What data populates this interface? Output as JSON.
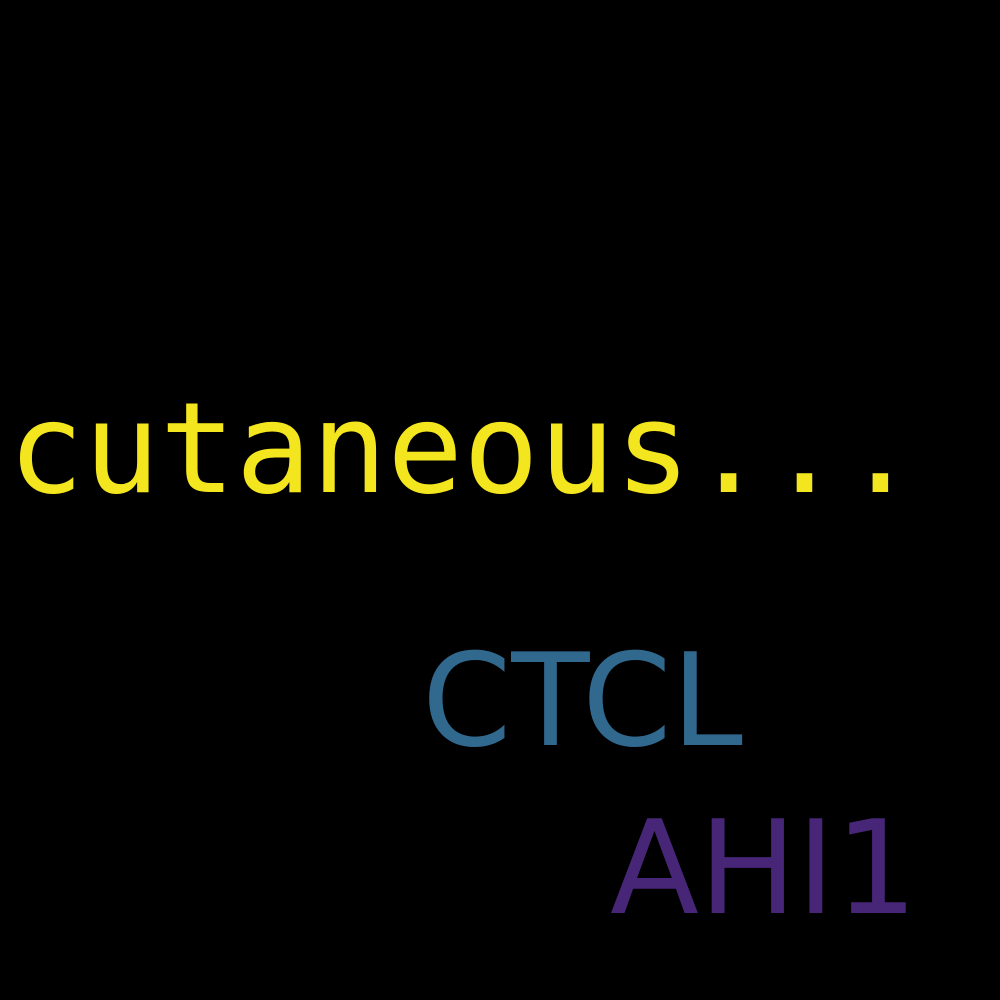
{
  "background_color": "#000000",
  "words": [
    {
      "text": "cutaneous...",
      "color": "#f4e61e"
    },
    {
      "text": "CTCL",
      "color": "#31688e"
    },
    {
      "text": "AHI1",
      "color": "#482677"
    }
  ]
}
